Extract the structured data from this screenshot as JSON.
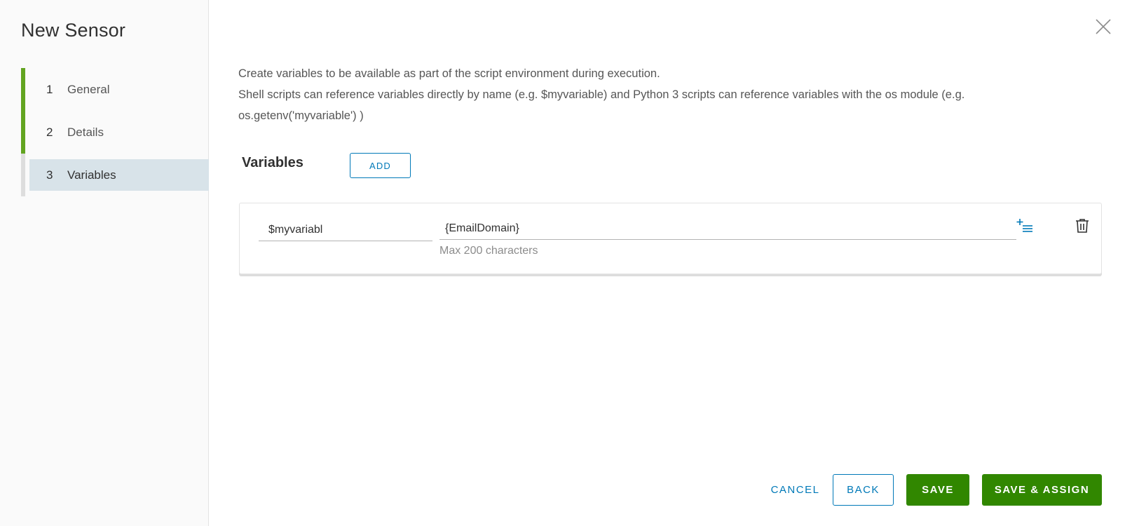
{
  "wizard": {
    "title": "New Sensor",
    "steps": [
      {
        "num": "1",
        "label": "General"
      },
      {
        "num": "2",
        "label": "Details"
      },
      {
        "num": "3",
        "label": "Variables"
      }
    ]
  },
  "main": {
    "description_line1": "Create variables to be available as part of the script environment during execution.",
    "description_line2": "Shell scripts can reference variables directly by name (e.g. $myvariable) and Python 3 scripts can reference variables with the os module (e.g. os.getenv('myvariable') )",
    "section_title": "Variables",
    "add_label": "ADD",
    "variable": {
      "name": "$myvariabl",
      "value": "{EmailDomain}",
      "helper": "Max 200 characters"
    }
  },
  "footer": {
    "cancel_label": "CANCEL",
    "back_label": "BACK",
    "save_label": "SAVE",
    "save_assign_label": "SAVE & ASSIGN"
  },
  "colors": {
    "accent_blue": "#0079b8",
    "success_green": "#318700",
    "step_done": "#62a420",
    "active_step_bg": "#d8e3e9"
  },
  "icons": {
    "close": "close-icon",
    "insert_lookup": "insert-lookup-icon",
    "delete": "trash-icon"
  }
}
